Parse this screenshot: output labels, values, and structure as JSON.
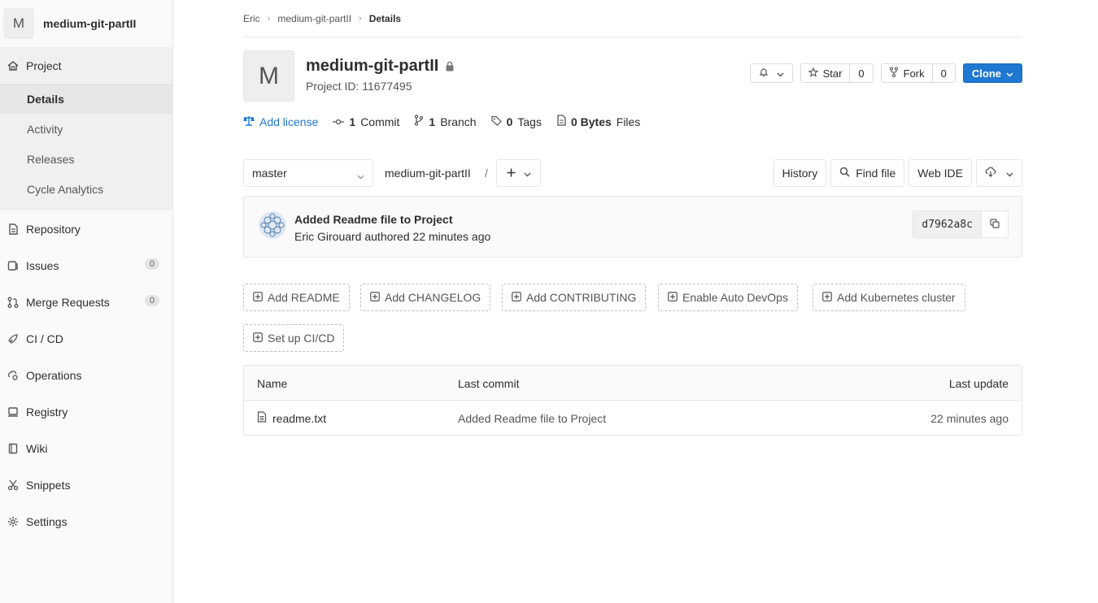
{
  "sidebar": {
    "project_avatar_letter": "M",
    "project_name": "medium-git-partII",
    "project_nav_label": "Project",
    "sub_items": [
      {
        "label": "Details"
      },
      {
        "label": "Activity"
      },
      {
        "label": "Releases"
      },
      {
        "label": "Cycle Analytics"
      }
    ],
    "items": [
      {
        "label": "Repository",
        "icon": "doc-icon"
      },
      {
        "label": "Issues",
        "icon": "issues-icon",
        "count": "0"
      },
      {
        "label": "Merge Requests",
        "icon": "merge-request-icon",
        "count": "0"
      },
      {
        "label": "CI / CD",
        "icon": "rocket-icon"
      },
      {
        "label": "Operations",
        "icon": "cloud-gear-icon"
      },
      {
        "label": "Registry",
        "icon": "container-icon"
      },
      {
        "label": "Wiki",
        "icon": "book-icon"
      },
      {
        "label": "Snippets",
        "icon": "scissors-icon"
      },
      {
        "label": "Settings",
        "icon": "gear-icon"
      }
    ]
  },
  "breadcrumb": {
    "items": [
      "Eric",
      "medium-git-partII"
    ],
    "current": "Details"
  },
  "project": {
    "avatar_letter": "M",
    "title": "medium-git-partII",
    "project_id": "Project ID: 11677495"
  },
  "actions": {
    "star_label": "Star",
    "star_count": "0",
    "fork_label": "Fork",
    "fork_count": "0",
    "clone_label": "Clone"
  },
  "stats": {
    "license": "Add license",
    "commits_num": "1",
    "commits_label": "Commit",
    "branches_num": "1",
    "branches_label": "Branch",
    "tags_num": "0",
    "tags_label": "Tags",
    "files_num": "0 Bytes",
    "files_label": "Files"
  },
  "toolbar": {
    "branch": "master",
    "path": "medium-git-partII",
    "path_sep": "/",
    "history": "History",
    "find_file": "Find file",
    "web_ide": "Web IDE"
  },
  "commit": {
    "title": "Added Readme file to Project",
    "author": "Eric Girouard",
    "action": "authored",
    "time": "22 minutes ago",
    "sha": "d7962a8c"
  },
  "quick_actions": [
    "Add README",
    "Add CHANGELOG",
    "Add CONTRIBUTING",
    "Enable Auto DevOps",
    "Add Kubernetes cluster",
    "Set up CI/CD"
  ],
  "tree": {
    "headers": {
      "name": "Name",
      "last_commit": "Last commit",
      "last_update": "Last update"
    },
    "rows": [
      {
        "name": "readme.txt",
        "last_commit": "Added Readme file to Project",
        "last_update": "22 minutes ago"
      }
    ]
  },
  "colors": {
    "primary": "#1f78d1",
    "sidebar_bg": "#fafafa",
    "border": "#e5e5e5"
  }
}
